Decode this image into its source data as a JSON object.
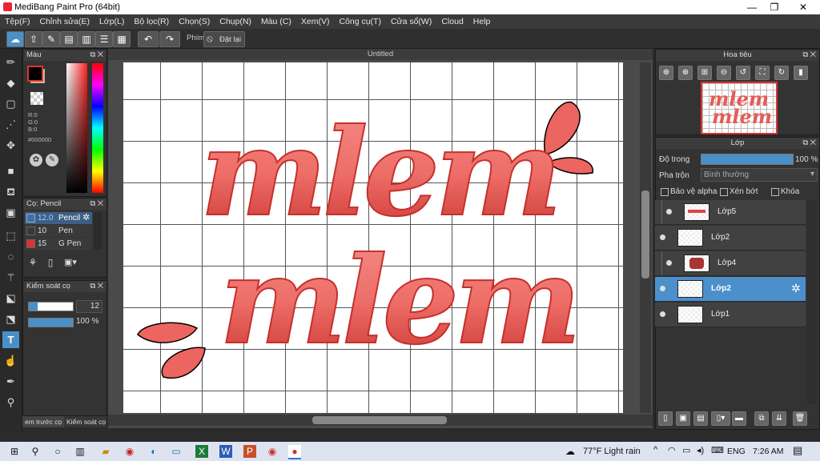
{
  "window": {
    "title": "MediBang Paint Pro (64bit)",
    "minimize": "—",
    "maximize": "❐",
    "close": "✕"
  },
  "menu": [
    "Tệp(F)",
    "Chỉnh sửa(E)",
    "Lớp(L)",
    "Bộ lọc(R)",
    "Chọn(S)",
    "Chụp(N)",
    "Màu (C)",
    "Xem(V)",
    "Công cụ(T)",
    "Cửa sổ(W)",
    "Cloud",
    "Help"
  ],
  "toolbar": {
    "shortcut_label": "Phím",
    "reset_label": "Đặt lại"
  },
  "color_panel": {
    "title": "Màu",
    "r": "R:0",
    "g": "G:0",
    "b": "B:0",
    "hex": "#000000",
    "fg_color": "#000000",
    "bg_color": "#f3c98a"
  },
  "brush_panel": {
    "title": "Cọ: Pencil",
    "items": [
      {
        "size": "12.0",
        "name": "Pencil",
        "color": "#3a6fb0"
      },
      {
        "size": "10",
        "name": "Pen",
        "color": "#3a3a3a"
      },
      {
        "size": "15",
        "name": "G Pen",
        "color": "#e03030"
      }
    ]
  },
  "brush_control": {
    "title": "Kiểm soát cọ",
    "size_value": "12",
    "opacity_value": "100 %",
    "size_fraction": 0.2,
    "opacity_fraction": 1.0
  },
  "left_tabs": [
    "em trước cọ",
    "Kiểm soát cọ"
  ],
  "canvas": {
    "title": "Untitled",
    "text_line1": "mlem",
    "text_line2": "mlem"
  },
  "navigator": {
    "title": "Hoa tiêu"
  },
  "layer_panel": {
    "title": "Lớp",
    "opacity_label": "Độ trong",
    "opacity_value": "100 %",
    "blend_label": "Pha trộn",
    "blend_value": "Bình thường",
    "protect_alpha": "Bảo vệ alpha",
    "clipping": "Xén bớt",
    "lock": "Khóa",
    "layers": [
      {
        "name": "Lớp5",
        "selected": false
      },
      {
        "name": "Lớp2",
        "selected": false
      },
      {
        "name": "Lớp4",
        "selected": false
      },
      {
        "name": "Lớp2",
        "selected": true
      },
      {
        "name": "Lớp1",
        "selected": false
      }
    ]
  },
  "taskbar": {
    "weather": "77°F  Light rain",
    "lang": "ENG",
    "time": "7:26 AM"
  }
}
